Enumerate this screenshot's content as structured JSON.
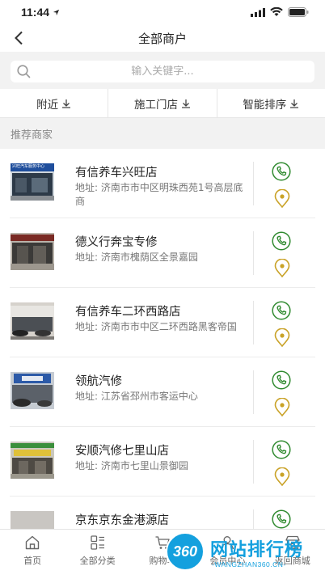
{
  "status_bar": {
    "time": "11:44"
  },
  "nav": {
    "title": "全部商户"
  },
  "search": {
    "placeholder": "输入关键字..."
  },
  "filters": [
    {
      "label": "附近"
    },
    {
      "label": "施工门店"
    },
    {
      "label": "智能排序"
    }
  ],
  "section": {
    "title": "推荐商家"
  },
  "shops": [
    {
      "name": "有信养车兴旺店",
      "address": "地址: 济南市市中区明珠西苑1号高层底商",
      "thumb_sign": "兴旺汽车服务中心"
    },
    {
      "name": "德义行奔宝专修",
      "address": "地址: 济南市槐荫区全景嘉园",
      "thumb_sign": ""
    },
    {
      "name": "有信养车二环西路店",
      "address": "地址: 济南市市中区二环西路黑客帝国",
      "thumb_sign": ""
    },
    {
      "name": "领航汽修",
      "address": "地址: 江苏省邳州市客运中心",
      "thumb_sign": ""
    },
    {
      "name": "安顺汽修七里山店",
      "address": "地址: 济南市七里山景御园",
      "thumb_sign": ""
    },
    {
      "name": "京东京东金港源店",
      "address": "",
      "thumb_sign": ""
    }
  ],
  "tabs": [
    {
      "label": "首页",
      "icon": "home-icon"
    },
    {
      "label": "全部分类",
      "icon": "category-icon"
    },
    {
      "label": "购物车",
      "icon": "cart-icon"
    },
    {
      "label": "会员中心",
      "icon": "member-icon"
    },
    {
      "label": "返回商城",
      "icon": "store-icon"
    }
  ],
  "watermark": {
    "badge": "360",
    "title": "网站排行榜",
    "subtitle": "-WANGZHAN360.CN-"
  },
  "colors": {
    "accent_green": "#2f8a2f",
    "location_gold": "#c9a227",
    "watermark_blue": "#14a0de"
  }
}
